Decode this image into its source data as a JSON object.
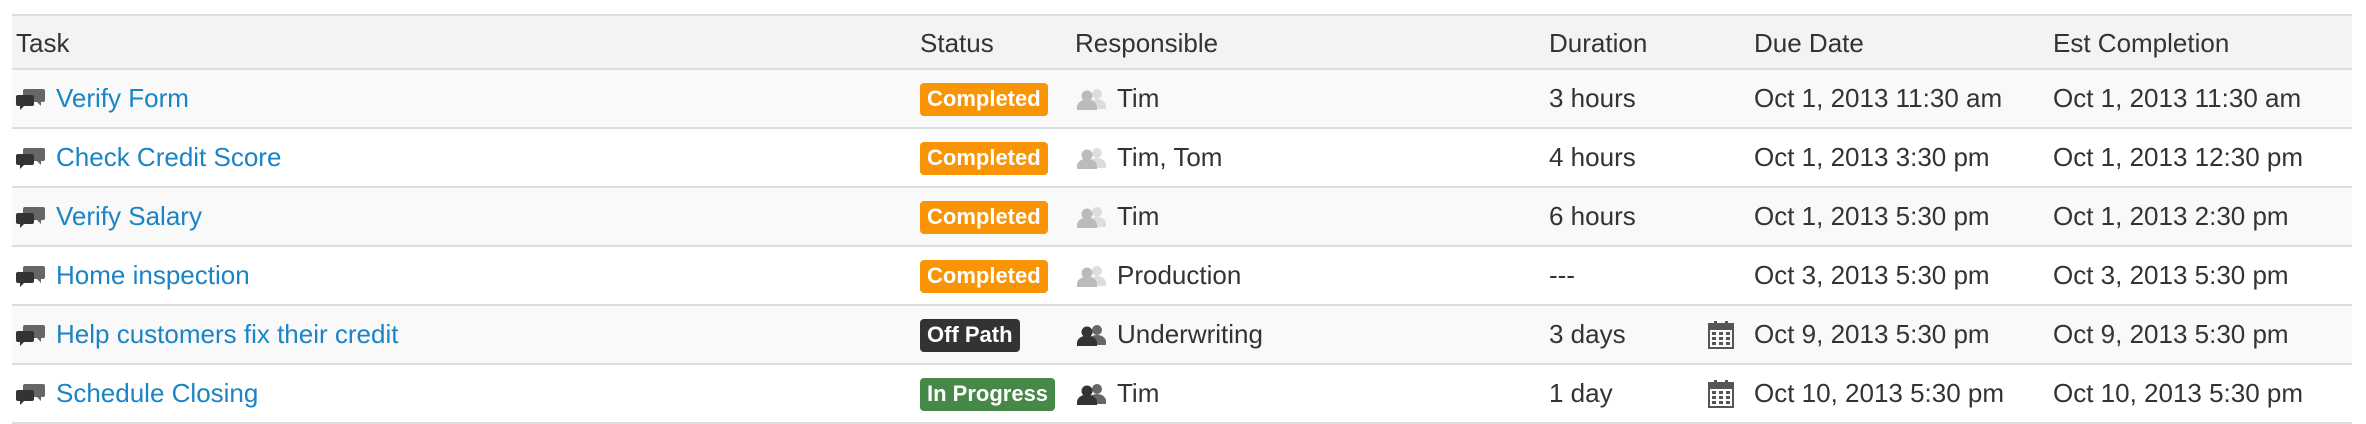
{
  "table": {
    "headers": {
      "task": "Task",
      "status": "Status",
      "responsible": "Responsible",
      "duration": "Duration",
      "due_date": "Due Date",
      "est_completion": "Est Completion"
    },
    "rows": [
      {
        "task": "Verify Form",
        "status": "Completed",
        "status_color": "#f89406",
        "responsible": "Tim",
        "people_icon": "people-icon-light",
        "duration": "3 hours",
        "calendar": false,
        "due_date": "Oct 1, 2013 11:30 am",
        "est_completion": "Oct 1, 2013 11:30 am"
      },
      {
        "task": "Check Credit Score",
        "status": "Completed",
        "status_color": "#f89406",
        "responsible": "Tim, Tom",
        "people_icon": "people-icon-light",
        "duration": "4 hours",
        "calendar": false,
        "due_date": "Oct 1, 2013 3:30 pm",
        "est_completion": "Oct 1, 2013 12:30 pm"
      },
      {
        "task": "Verify Salary",
        "status": "Completed",
        "status_color": "#f89406",
        "responsible": "Tim",
        "people_icon": "people-icon-light",
        "duration": "6 hours",
        "calendar": false,
        "due_date": "Oct 1, 2013 5:30 pm",
        "est_completion": "Oct 1, 2013 2:30 pm"
      },
      {
        "task": "Home inspection",
        "status": "Completed",
        "status_color": "#f89406",
        "responsible": "Production",
        "people_icon": "people-icon-light",
        "duration": "---",
        "calendar": false,
        "due_date": "Oct 3, 2013 5:30 pm",
        "est_completion": "Oct 3, 2013 5:30 pm"
      },
      {
        "task": "Help customers fix their credit",
        "status": "Off Path",
        "status_color": "#333333",
        "responsible": "Underwriting",
        "people_icon": "people-icon-dark",
        "duration": "3 days",
        "calendar": true,
        "due_date": "Oct 9, 2013 5:30 pm",
        "est_completion": "Oct 9, 2013 5:30 pm"
      },
      {
        "task": "Schedule Closing",
        "status": "In Progress",
        "status_color": "#468847",
        "responsible": "Tim",
        "people_icon": "people-icon-dark",
        "duration": "1 day",
        "calendar": true,
        "due_date": "Oct 10, 2013 5:30 pm",
        "est_completion": "Oct 10, 2013 5:30 pm"
      }
    ]
  },
  "icons": {
    "task": "comments-icon",
    "responsible_done": "people-icon-light",
    "responsible_active": "people-icon-dark",
    "due_date": "calendar-icon"
  },
  "colors": {
    "link": "#1a84c4",
    "completed": "#f89406",
    "off_path": "#333333",
    "in_progress": "#468847",
    "header_bg": "#f3f3f3",
    "stripe": "#f9f9f9",
    "border": "#dddddd"
  }
}
